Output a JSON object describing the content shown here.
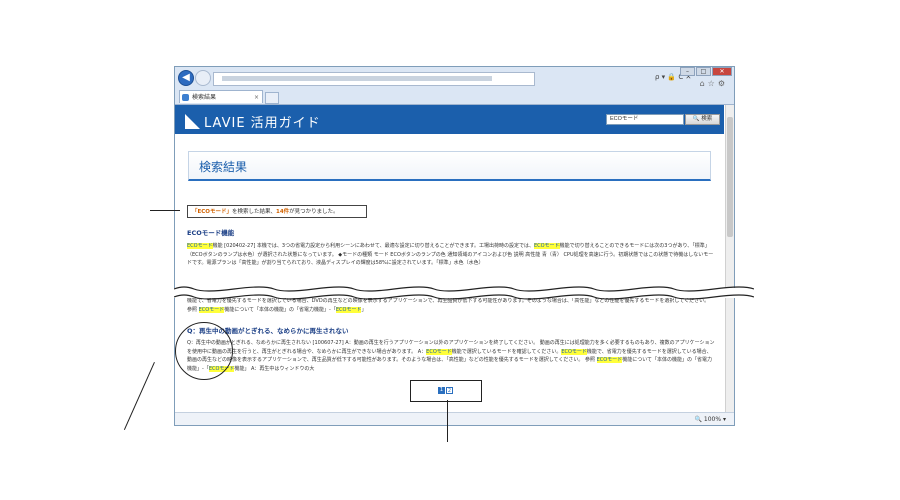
{
  "tab": {
    "title": "検索結果"
  },
  "header": {
    "logo": "LAVIE 活用ガイド",
    "search_value": "ECOモード",
    "search_button": "検索"
  },
  "page_title": "検索結果",
  "result_summary": {
    "keyword": "「ECOモード」",
    "middle": "を検索した結果、",
    "count": "14件",
    "suffix": "が見つかりました。"
  },
  "results": [
    {
      "title": "ECOモード機能",
      "body_pre": "",
      "hl1": "ECOモード",
      "body_mid": "機能 [020402-27] 本機では、3つの省電力設定から利用シーンにあわせて、最適な設定に切り替えることができます。工場出荷時の設定では、",
      "hl2": "ECOモード",
      "body_post": "機能で切り替えることのできるモードには次の3つがあり、「標準」（ECOボタンのランプは水色）が選択された状態になっています。 ◆モードの種類 モード ECOボタンのランプの色 通知領域のアイコンおよび色 説明 高性能 青（青） CPU処理を高速に行う。初期状態ではこの状態で待機はしないモードです。電源プランは「高性能」が割り当てられており、液晶ディスプレイの輝度は58%に設定されています。「標準」水色（水色）"
    }
  ],
  "fragment": {
    "pre": "機能で、省電力を優先するモードを選択している場合、DVDの再生などの映像を表示するアプリケーションで、再生品質が低下する可能性があります。そのような場合は、「高性能」などの性能を優先するモードを選択してください。 参照 ",
    "hl1": "ECOモード",
    "mid": "機能について「本体の機能」の「省電力機能」-「",
    "hl2": "ECOモード",
    "post": "」"
  },
  "result2": {
    "title": "Q：再生中の動画がとぎれる、なめらかに再生されない",
    "pre": "Q：再生中の動画がとぎれる、なめらかに再生されない [100607-27] A：動画の再生を行うアプリケーション以外のアプリケーションを終了してください。 動画の再生には処理能力を多く必要するものもあり、複数のアプリケーションを使用中に動画の再生を行うと、再生がとぎれる場合や、なめらかに再生ができない場合があります。 A：",
    "hl1": "ECOモード",
    "mid1": "機能で選択しているモードを確認してください。",
    "hl2": "ECOモード",
    "mid2": "機能で、省電力を優先するモードを選択している場合、動画の再生などの映像を表示するアプリケーションで、再生品質が低下する可能性があります。そのような場合は、「高性能」などの性能を優先するモードを選択してください。 参照 ",
    "hl3": "ECOモード",
    "mid3": "機能について「本体の機能」の「省電力機能」-「",
    "hl4": "ECOモード",
    "post": "機能」 A：再生中はウィンドウの大"
  },
  "pagination": {
    "page1": "1",
    "page2": "2"
  },
  "status": {
    "zoom": "100%"
  }
}
